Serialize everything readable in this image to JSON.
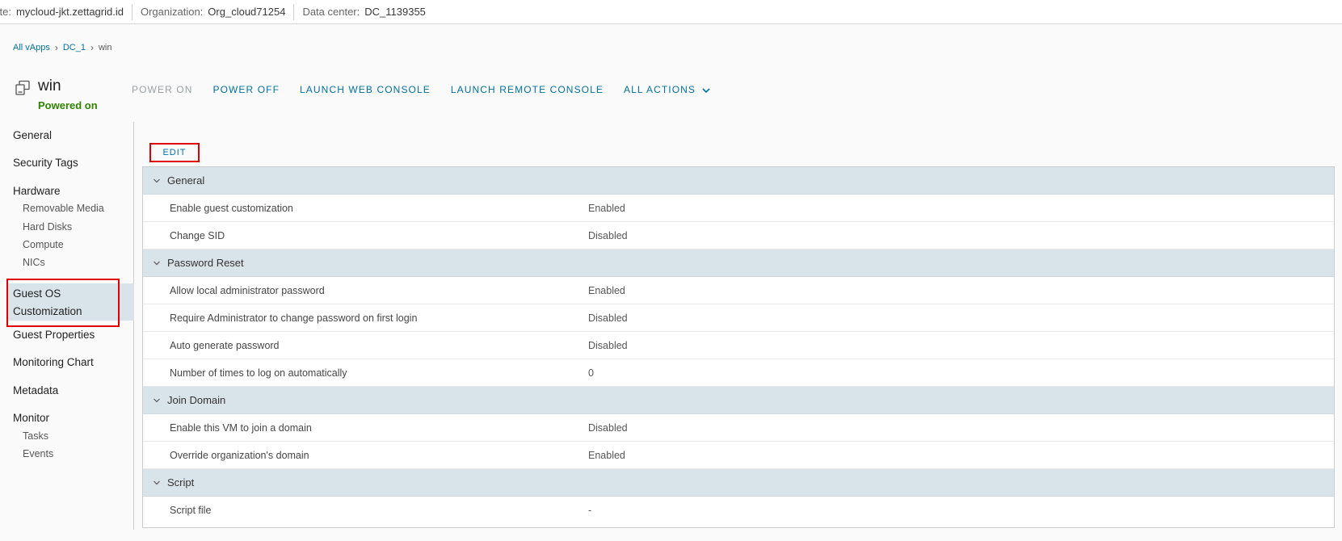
{
  "topbar": {
    "site_label": "Site:",
    "site_value": "mycloud-jkt.zettagrid.id",
    "org_label": "Organization:",
    "org_value": "Org_cloud71254",
    "dc_label": "Data center:",
    "dc_value": "DC_1139355"
  },
  "breadcrumb": [
    "All vApps",
    "DC_1",
    "win"
  ],
  "vm": {
    "name": "win",
    "status": "Powered on"
  },
  "actions": {
    "power_on": "POWER ON",
    "power_off": "POWER OFF",
    "launch_web_console": "LAUNCH WEB CONSOLE",
    "launch_remote_console": "LAUNCH REMOTE CONSOLE",
    "all_actions": "ALL ACTIONS"
  },
  "nav": {
    "general": "General",
    "security_tags": "Security Tags",
    "hardware": "Hardware",
    "removable_media": "Removable Media",
    "hard_disks": "Hard Disks",
    "compute": "Compute",
    "nics": "NICs",
    "guest_os_line1": "Guest OS",
    "guest_os_line2": "Customization",
    "guest_properties": "Guest Properties",
    "monitoring_chart": "Monitoring Chart",
    "metadata": "Metadata",
    "monitor": "Monitor",
    "tasks": "Tasks",
    "events": "Events"
  },
  "edit_label": "EDIT",
  "sections": [
    {
      "title": "General",
      "rows": [
        {
          "label": "Enable guest customization",
          "value": "Enabled"
        },
        {
          "label": "Change SID",
          "value": "Disabled"
        }
      ]
    },
    {
      "title": "Password Reset",
      "rows": [
        {
          "label": "Allow local administrator password",
          "value": "Enabled"
        },
        {
          "label": "Require Administrator to change password on first login",
          "value": "Disabled"
        },
        {
          "label": "Auto generate password",
          "value": "Disabled"
        },
        {
          "label": "Number of times to log on automatically",
          "value": "0"
        }
      ]
    },
    {
      "title": "Join Domain",
      "rows": [
        {
          "label": "Enable this VM to join a domain",
          "value": "Disabled"
        },
        {
          "label": "Override organization's domain",
          "value": "Enabled"
        }
      ]
    },
    {
      "title": "Script",
      "rows": [
        {
          "label": "Script file",
          "value": "-"
        }
      ]
    }
  ],
  "colors": {
    "accent": "#0072a3",
    "status_on": "#2f8400",
    "highlight_box": "#e10000",
    "section_bg": "#d9e3ea"
  },
  "icons": [
    "vm-icon",
    "chevron-right-icon",
    "chevron-down-icon"
  ]
}
